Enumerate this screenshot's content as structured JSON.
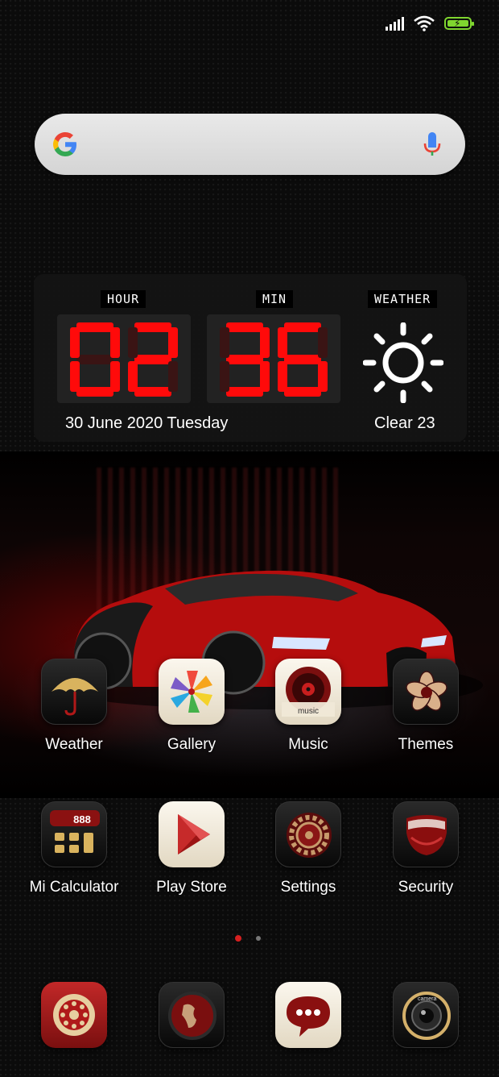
{
  "status_bar": {
    "icons": [
      "signal-icon",
      "wifi-icon",
      "battery-charging-icon"
    ],
    "battery_color": "#7fd62f"
  },
  "search": {
    "logo": "google-g-icon",
    "mic": "mic-icon"
  },
  "clock_widget": {
    "hour_label": "HOUR",
    "min_label": "MIN",
    "weather_label": "WEATHER",
    "hour": "02",
    "minute": "36",
    "date": "30 June 2020 Tuesday",
    "weather_text": "Clear 23",
    "digit_color": "#ff0a0a"
  },
  "apps_row1": [
    {
      "label": "Weather",
      "icon": "umbrella-icon"
    },
    {
      "label": "Gallery",
      "icon": "pinwheel-icon"
    },
    {
      "label": "Music",
      "icon": "vinyl-icon",
      "icon_text": "music"
    },
    {
      "label": "Themes",
      "icon": "flower-icon"
    }
  ],
  "apps_row2": [
    {
      "label": "Mi Calculator",
      "icon": "calculator-icon",
      "icon_text": "888"
    },
    {
      "label": "Play Store",
      "icon": "play-store-icon"
    },
    {
      "label": "Settings",
      "icon": "gear-icon"
    },
    {
      "label": "Security",
      "icon": "shield-icon"
    }
  ],
  "dock": [
    {
      "icon": "rotary-phone-icon"
    },
    {
      "icon": "globe-icon"
    },
    {
      "icon": "chat-bubble-icon"
    },
    {
      "icon": "camera-icon",
      "icon_text": "camera"
    }
  ],
  "page_indicator": {
    "pages": 2,
    "current": 1
  }
}
